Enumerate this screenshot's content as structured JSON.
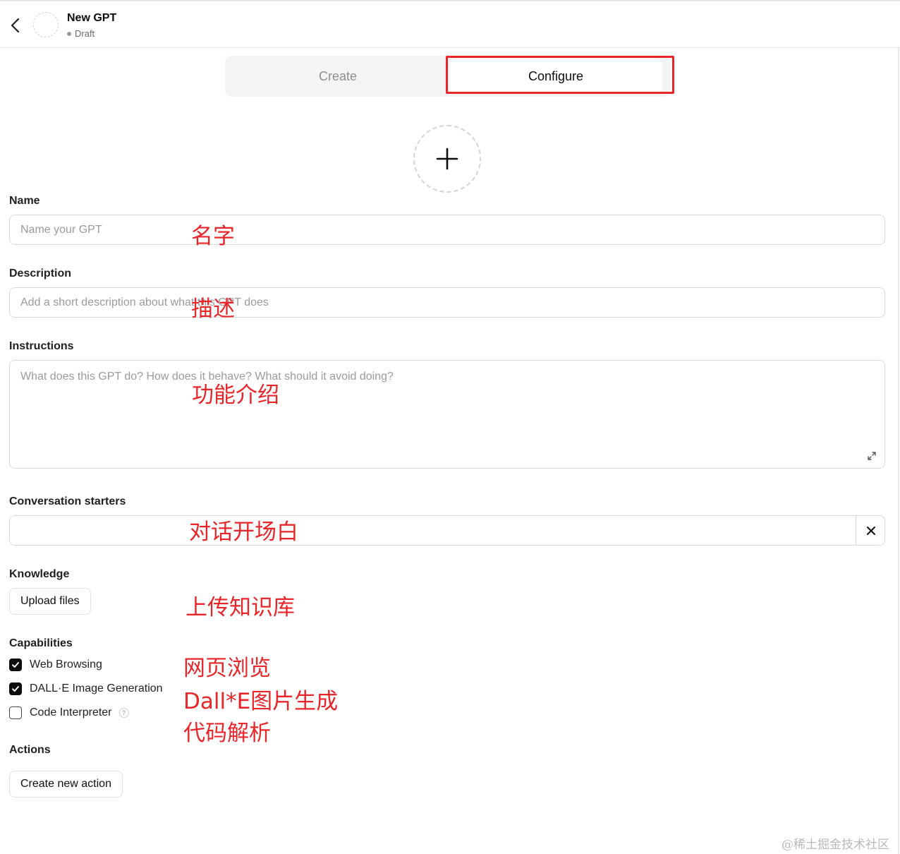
{
  "header": {
    "title": "New GPT",
    "status": "Draft"
  },
  "tabs": [
    {
      "label": "Create",
      "active": false
    },
    {
      "label": "Configure",
      "active": true
    }
  ],
  "form": {
    "name": {
      "label": "Name",
      "placeholder": "Name your GPT",
      "value": ""
    },
    "description": {
      "label": "Description",
      "placeholder": "Add a short description about what this GPT does",
      "value": ""
    },
    "instructions": {
      "label": "Instructions",
      "placeholder": "What does this GPT do? How does it behave? What should it avoid doing?",
      "value": ""
    },
    "conversation_starters": {
      "label": "Conversation starters",
      "value": ""
    },
    "knowledge": {
      "label": "Knowledge",
      "upload_label": "Upload files"
    },
    "capabilities": {
      "label": "Capabilities",
      "items": [
        {
          "label": "Web Browsing",
          "checked": true
        },
        {
          "label": "DALL·E Image Generation",
          "checked": true
        },
        {
          "label": "Code Interpreter",
          "checked": false
        }
      ]
    },
    "actions": {
      "label": "Actions",
      "create_label": "Create new action"
    }
  },
  "annotations": {
    "name": "名字",
    "description": "描述",
    "instructions": "功能介绍",
    "starters": "对话开场白",
    "knowledge": "上传知识库",
    "web": "网页浏览",
    "dalle": "Dall*E图片生成",
    "code": "代码解析"
  },
  "watermark": "@稀土掘金技术社区",
  "colors": {
    "annotation_red": "#e8262a",
    "checkbox_checked": "#0d0d0d",
    "tab_track": "#f4f4f5"
  },
  "icons": {
    "back": "chevron-left-icon",
    "avatar_upload": "plus-icon",
    "expand": "expand-icon",
    "remove_starter": "close-icon",
    "checkbox": "check-icon",
    "help": "question-icon"
  }
}
